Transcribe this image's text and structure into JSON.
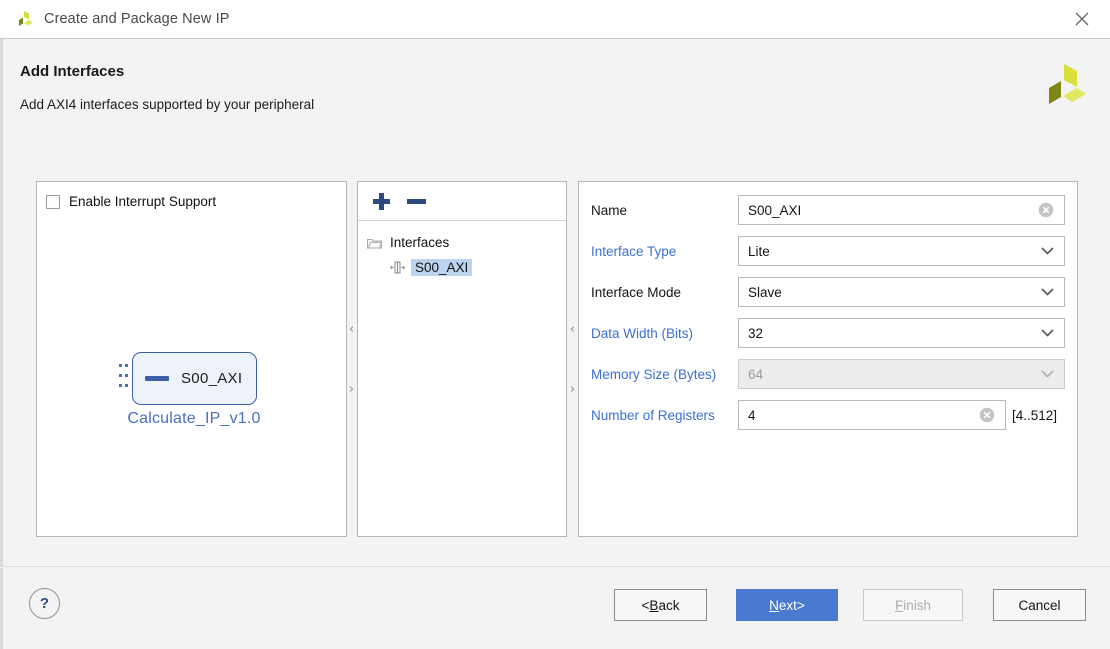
{
  "titlebar": {
    "title": "Create and Package New IP",
    "logo_icon": "xilinx-pinwheel-icon",
    "close_icon": "close-icon"
  },
  "header": {
    "title": "Add Interfaces",
    "subtitle": "Add AXI4 interfaces supported by your peripheral",
    "logo_icon": "xilinx-pinwheel-icon"
  },
  "left_panel": {
    "checkbox": {
      "label": "Enable Interrupt Support",
      "checked": false
    },
    "diagram": {
      "block_label": "S00_AXI",
      "ip_name": "Calculate_IP_v1.0",
      "block_fill": "#eef2fa",
      "block_border": "#3a5fa8",
      "name_color": "#4a6fc0"
    }
  },
  "middle_panel": {
    "toolbar": {
      "add_icon": "plus-icon",
      "remove_icon": "minus-icon"
    },
    "tree": {
      "root": {
        "label": "Interfaces",
        "icon": "folder-icon"
      },
      "children": [
        {
          "label": "S00_AXI",
          "icon": "bus-interface-icon",
          "selected": true
        }
      ]
    }
  },
  "right_panel": {
    "fields": [
      {
        "label": "Name",
        "label_color": "black",
        "value": "S00_AXI",
        "control": "text",
        "clear_icon": "clear-circle-icon",
        "disabled": false
      },
      {
        "label": "Interface Type",
        "label_color": "blue",
        "value": "Lite",
        "control": "select",
        "dropdown_icon": "chevron-down-icon",
        "disabled": false
      },
      {
        "label": "Interface Mode",
        "label_color": "black",
        "value": "Slave",
        "control": "select",
        "dropdown_icon": "chevron-down-icon",
        "disabled": false
      },
      {
        "label": "Data Width (Bits)",
        "label_color": "blue",
        "value": "32",
        "control": "select",
        "dropdown_icon": "chevron-down-icon",
        "disabled": false
      },
      {
        "label": "Memory Size (Bytes)",
        "label_color": "blue",
        "value": "64",
        "control": "select",
        "dropdown_icon": "chevron-down-icon",
        "disabled": true
      },
      {
        "label": "Number of Registers",
        "label_color": "blue",
        "value": "4",
        "control": "text",
        "clear_icon": "clear-circle-icon",
        "range_hint": "[4..512]",
        "disabled": false
      }
    ]
  },
  "splitters": {
    "collapse_icon": "chevron-left-icon",
    "expand_icon": "chevron-right-icon",
    "left_label": "‹",
    "right_label": "›"
  },
  "footer": {
    "help_label": "?",
    "buttons": {
      "back": {
        "prefix": "< ",
        "accel": "B",
        "rest": "ack"
      },
      "next": {
        "accel": "N",
        "rest": "ext",
        "suffix": " >"
      },
      "finish": {
        "accel": "F",
        "rest": "inish"
      },
      "cancel": {
        "label": "Cancel"
      }
    }
  },
  "colors": {
    "accent_blue": "#4a7ad0",
    "link_blue": "#3b6fd4",
    "icon_navy": "#2d4a80",
    "selection_blue": "#bcd4f0",
    "logo_green_light": "#d7df38",
    "logo_green_mid": "#c2cc2e",
    "logo_green_dark": "#7d8718"
  }
}
